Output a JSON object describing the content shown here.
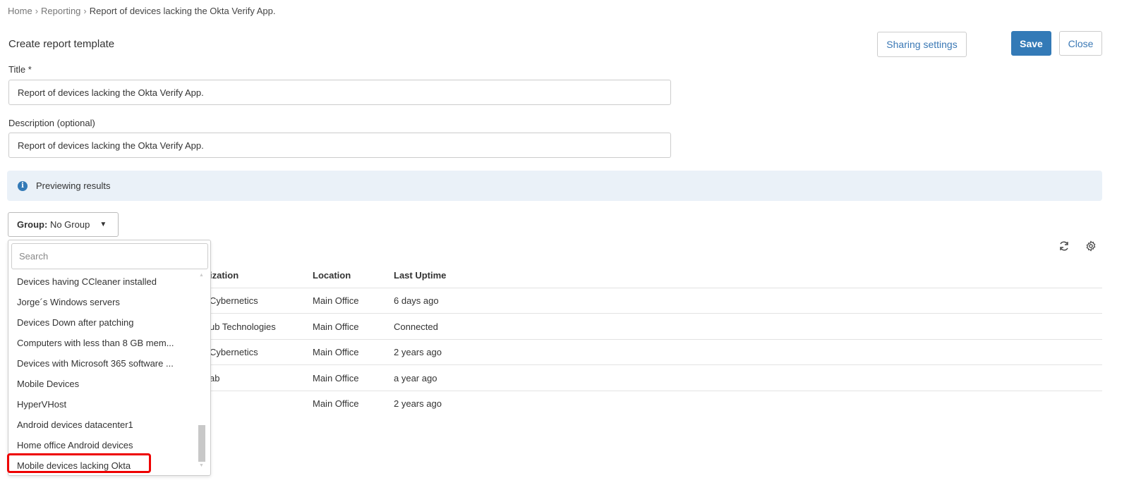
{
  "breadcrumb": {
    "items": [
      "Home",
      "Reporting"
    ],
    "current": "Report of devices lacking the Okta Verify App."
  },
  "page_title": "Create report template",
  "buttons": {
    "sharing": "Sharing settings",
    "save": "Save",
    "close": "Close"
  },
  "form": {
    "title_label": "Title *",
    "title_value": "Report of devices lacking the Okta Verify App.",
    "desc_label": "Description (optional)",
    "desc_value": "Report of devices lacking the Okta Verify App."
  },
  "banner": {
    "text": "Previewing results",
    "icon": "info-icon"
  },
  "group": {
    "label": "Group:",
    "value": "No Group"
  },
  "dropdown": {
    "search_placeholder": "Search",
    "items": [
      "Devices having CCleaner installed",
      "Jorge´s Windows servers",
      "Devices Down after patching",
      "Computers with less than 8 GB mem...",
      "Devices with Microsoft 365 software ...",
      "Mobile Devices",
      "HyperVHost",
      "Android devices datacenter1",
      "Home office Android devices",
      "Mobile devices lacking Okta"
    ],
    "highlighted": "Mobile devices lacking Okta"
  },
  "table": {
    "headers": [
      "ization",
      "Location",
      "Last Uptime"
    ],
    "rows": [
      [
        "Cybernetics",
        "Main Office",
        "6 days ago"
      ],
      [
        "ub Technologies",
        "Main Office",
        "Connected"
      ],
      [
        "Cybernetics",
        "Main Office",
        "2 years ago"
      ],
      [
        "ab",
        "Main Office",
        "a year ago"
      ],
      [
        "",
        "Main Office",
        "2 years ago"
      ]
    ]
  },
  "colors": {
    "primary": "#337ab7",
    "highlight": "#e00000",
    "banner": "#eaf1f8"
  }
}
